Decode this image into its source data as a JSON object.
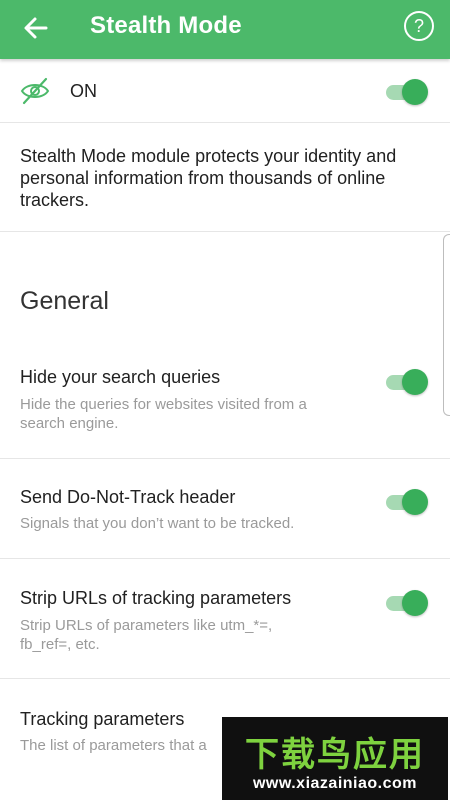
{
  "header": {
    "title": "Stealth Mode",
    "back_icon": "arrow-left-icon",
    "help_icon": "question-circle-icon",
    "help_symbol": "?",
    "background_color": "#4cb96a"
  },
  "status": {
    "icon": "eye-off-icon",
    "label": "ON",
    "enabled": true
  },
  "description": "Stealth Mode module protects your identity and personal information from thousands of online trackers.",
  "section": {
    "title": "General"
  },
  "settings": [
    {
      "title": "Hide your search queries",
      "subtitle": "Hide the queries for websites visited from a search engine.",
      "enabled": true
    },
    {
      "title": "Send Do-Not-Track header",
      "subtitle": "Signals that you don’t want to be tracked.",
      "enabled": true
    },
    {
      "title": "Strip URLs of tracking parameters",
      "subtitle": "Strip URLs of parameters like utm_*=, fb_ref=, etc.",
      "enabled": true
    },
    {
      "title": "Tracking parameters",
      "subtitle": "The list of parameters that a"
    }
  ],
  "watermark": {
    "brand": "下载鸟应用",
    "url": "www.xiazainiao.com"
  },
  "colors": {
    "accent": "#4cb96a",
    "toggle_thumb": "#38ae5a",
    "toggle_track": "#a6d9b3"
  }
}
